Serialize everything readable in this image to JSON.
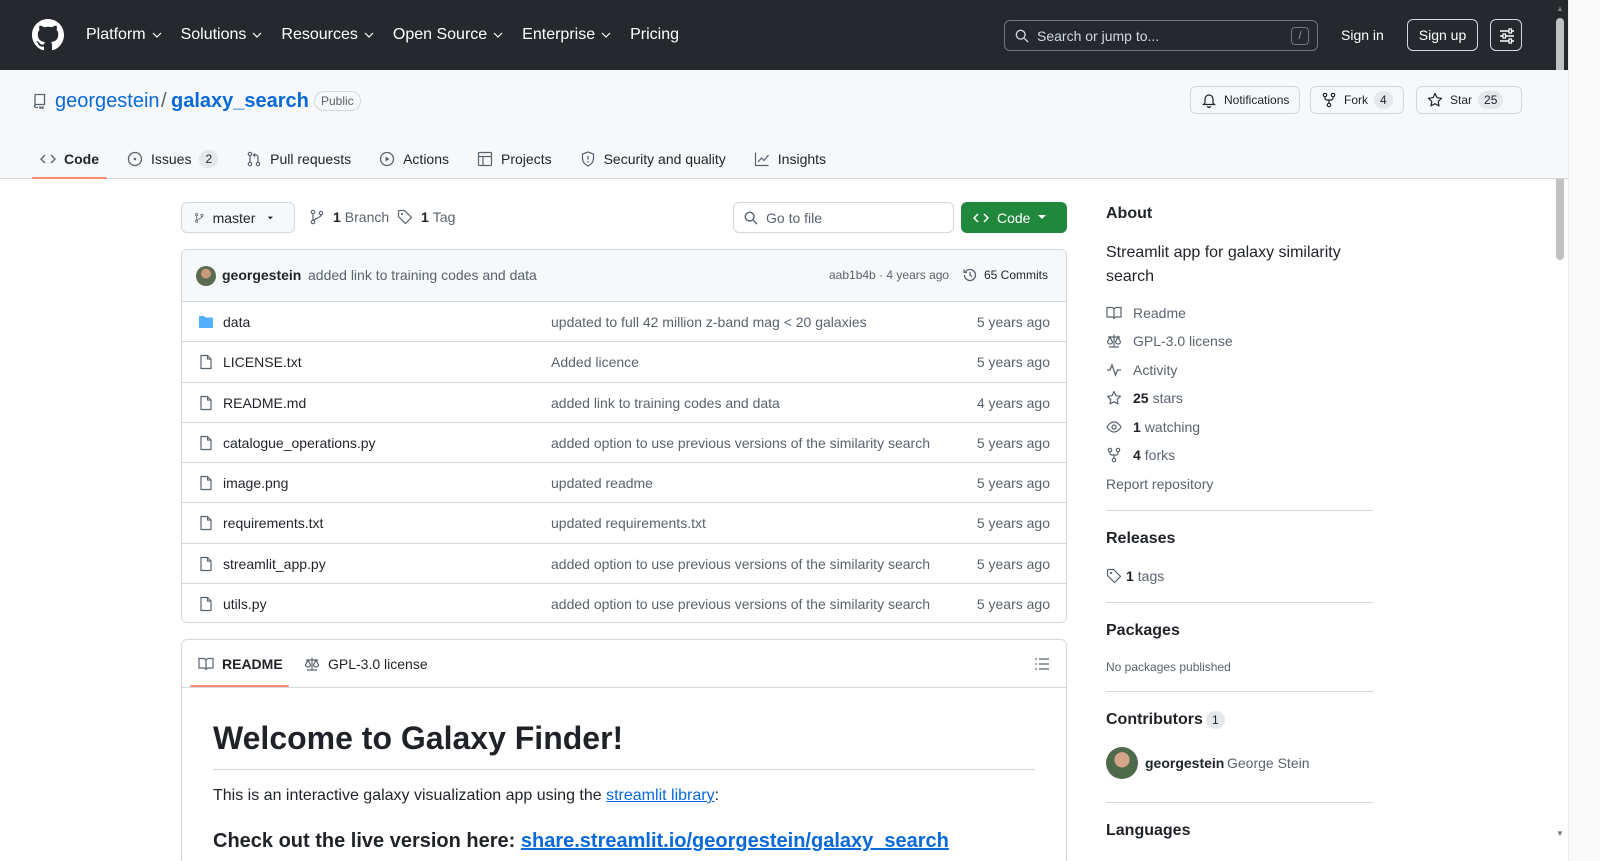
{
  "header": {
    "nav": [
      "Platform",
      "Solutions",
      "Resources",
      "Open Source",
      "Enterprise",
      "Pricing"
    ],
    "search_placeholder": "Search or jump to...",
    "search_shortcut": "/",
    "sign_in": "Sign in",
    "sign_up": "Sign up"
  },
  "repo": {
    "owner": "georgestein",
    "slash": "/",
    "name": "galaxy_search",
    "visibility": "Public",
    "notifications_label": "Notifications",
    "fork_label": "Fork",
    "fork_count": "4",
    "star_label": "Star",
    "star_count": "25"
  },
  "tabs": {
    "code": "Code",
    "issues": "Issues",
    "issues_count": "2",
    "pulls": "Pull requests",
    "actions": "Actions",
    "projects": "Projects",
    "security": "Security and quality",
    "insights": "Insights"
  },
  "branchbar": {
    "branch": "master",
    "branch_count": "1",
    "branch_label": "Branch",
    "tag_count": "1",
    "tag_label": "Tag",
    "goto_placeholder": "Go to file",
    "code_button": "Code"
  },
  "commit": {
    "author": "georgestein",
    "message": "added link to training codes and data",
    "hash_time": "aab1b4b · 4 years ago",
    "commits": "65 Commits"
  },
  "files": [
    {
      "name": "data",
      "type": "folder",
      "message": "updated to full 42 million z-band mag < 20 galaxies",
      "date": "5 years ago"
    },
    {
      "name": "LICENSE.txt",
      "type": "file",
      "message": "Added licence",
      "date": "5 years ago"
    },
    {
      "name": "README.md",
      "type": "file",
      "message": "added link to training codes and data",
      "date": "4 years ago"
    },
    {
      "name": "catalogue_operations.py",
      "type": "file",
      "message": "added option to use previous versions of the similarity search",
      "date": "5 years ago"
    },
    {
      "name": "image.png",
      "type": "file",
      "message": "updated readme",
      "date": "5 years ago"
    },
    {
      "name": "requirements.txt",
      "type": "file",
      "message": "updated requirements.txt",
      "date": "5 years ago"
    },
    {
      "name": "streamlit_app.py",
      "type": "file",
      "message": "added option to use previous versions of the similarity search",
      "date": "5 years ago"
    },
    {
      "name": "utils.py",
      "type": "file",
      "message": "added option to use previous versions of the similarity search",
      "date": "5 years ago"
    }
  ],
  "readme": {
    "tab_readme": "README",
    "tab_license": "GPL-3.0 license",
    "h1": "Welcome to Galaxy Finder!",
    "p_before": "This is an interactive galaxy visualization app using the ",
    "p_link": "streamlit library",
    "p_after": ":",
    "h2_before": "Check out the live version here: ",
    "h2_link": "share.streamlit.io/georgestein/galaxy_search"
  },
  "sidebar": {
    "about": "About",
    "description": "Streamlit app for galaxy similarity search",
    "readme": "Readme",
    "license": "GPL-3.0 license",
    "activity": "Activity",
    "stars_n": "25",
    "stars": "stars",
    "watching_n": "1",
    "watching": "watching",
    "forks_n": "4",
    "forks": "forks",
    "report": "Report repository",
    "releases": "Releases",
    "tags_n": "1",
    "tags": "tags",
    "packages": "Packages",
    "no_packages": "No packages published",
    "contributors": "Contributors",
    "contributors_count": "1",
    "contributor_login": "georgestein",
    "contributor_name": "George Stein",
    "languages": "Languages"
  }
}
